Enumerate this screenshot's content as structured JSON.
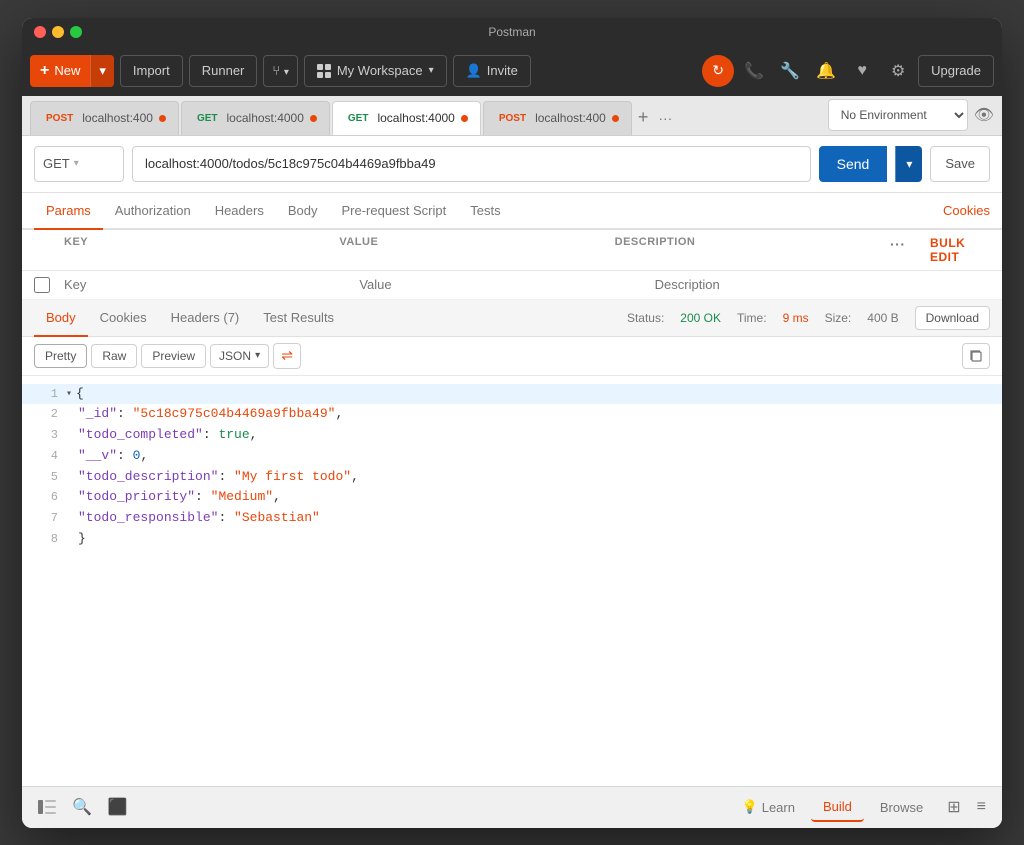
{
  "window": {
    "title": "Postman"
  },
  "toolbar": {
    "new_label": "New",
    "import_label": "Import",
    "runner_label": "Runner",
    "workspace_label": "My Workspace",
    "invite_label": "Invite",
    "upgrade_label": "Upgrade"
  },
  "tabs": [
    {
      "method": "POST",
      "url": "localhost:400",
      "active": false,
      "dot": true
    },
    {
      "method": "GET",
      "url": "localhost:4000",
      "active": false,
      "dot": true
    },
    {
      "method": "GET",
      "url": "localhost:4000",
      "active": true,
      "dot": true
    },
    {
      "method": "POST",
      "url": "localhost:400",
      "active": false,
      "dot": true
    }
  ],
  "request": {
    "method": "GET",
    "url": "localhost:4000/todos/5c18c975c04b4469a9fbba49",
    "send_label": "Send",
    "save_label": "Save"
  },
  "environment": {
    "label": "No Environment"
  },
  "request_tabs": [
    {
      "label": "Params",
      "active": true
    },
    {
      "label": "Authorization",
      "active": false
    },
    {
      "label": "Headers",
      "active": false
    },
    {
      "label": "Body",
      "active": false
    },
    {
      "label": "Pre-request Script",
      "active": false
    },
    {
      "label": "Tests",
      "active": false
    }
  ],
  "params_table": {
    "columns": [
      "KEY",
      "VALUE",
      "DESCRIPTION"
    ],
    "placeholder_key": "Key",
    "placeholder_value": "Value",
    "placeholder_desc": "Description"
  },
  "response_tabs": [
    {
      "label": "Body",
      "active": true
    },
    {
      "label": "Cookies",
      "active": false
    },
    {
      "label": "Headers (7)",
      "active": false
    },
    {
      "label": "Test Results",
      "active": false
    }
  ],
  "response_status": {
    "status_label": "Status:",
    "status_value": "200 OK",
    "time_label": "Time:",
    "time_value": "9 ms",
    "size_label": "Size:",
    "size_value": "400 B",
    "download_label": "Download"
  },
  "response_toolbar": {
    "pretty": "Pretty",
    "raw": "Raw",
    "preview": "Preview",
    "format": "JSON"
  },
  "response_body": {
    "lines": [
      {
        "num": "1",
        "arrow": true,
        "content": "{",
        "type": "plain"
      },
      {
        "num": "2",
        "content": "\"_id\": \"5c18c975c04b4469a9fbba49\",",
        "type": "id"
      },
      {
        "num": "3",
        "content": "\"todo_completed\": true,",
        "type": "bool"
      },
      {
        "num": "4",
        "content": "\"__v\": 0,",
        "type": "num"
      },
      {
        "num": "5",
        "content": "\"todo_description\": \"My first todo\",",
        "type": "string"
      },
      {
        "num": "6",
        "content": "\"todo_priority\": \"Medium\",",
        "type": "string"
      },
      {
        "num": "7",
        "content": "\"todo_responsible\": \"Sebastian\"",
        "type": "string"
      },
      {
        "num": "8",
        "content": "}",
        "type": "plain"
      }
    ]
  },
  "bottom_bar": {
    "learn_label": "Learn",
    "build_label": "Build",
    "browse_label": "Browse"
  }
}
